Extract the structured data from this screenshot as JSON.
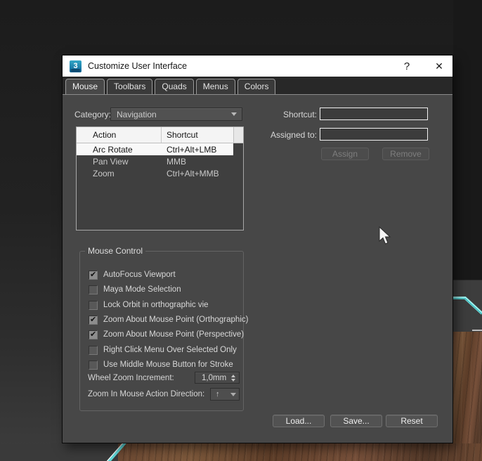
{
  "window": {
    "title": "Customize User Interface",
    "app_icon_text": "3",
    "help": "?",
    "close": "✕"
  },
  "tabs": {
    "items": [
      {
        "label": "Mouse"
      },
      {
        "label": "Toolbars"
      },
      {
        "label": "Quads"
      },
      {
        "label": "Menus"
      },
      {
        "label": "Colors"
      }
    ],
    "active": "Mouse"
  },
  "category": {
    "label": "Category:",
    "value": "Navigation"
  },
  "action_table": {
    "columns": [
      "Action",
      "Shortcut"
    ],
    "rows": [
      {
        "action": "Arc Rotate",
        "shortcut": "Ctrl+Alt+LMB",
        "selected": "true"
      },
      {
        "action": "Pan View",
        "shortcut": "MMB",
        "selected": "false"
      },
      {
        "action": "Zoom",
        "shortcut": "Ctrl+Alt+MMB",
        "selected": "false"
      }
    ]
  },
  "shortcut_panel": {
    "shortcut_label": "Shortcut:",
    "shortcut_value": "",
    "assigned_label": "Assigned to:",
    "assigned_value": "",
    "assign_button": "Assign",
    "remove_button": "Remove"
  },
  "mouse_control": {
    "title": "Mouse Control",
    "checkboxes": [
      {
        "label": "AutoFocus Viewport",
        "checked": "true"
      },
      {
        "label": "Maya Mode Selection",
        "checked": "false"
      },
      {
        "label": "Lock Orbit in orthographic vie",
        "checked": "false"
      },
      {
        "label": "Zoom About Mouse Point (Orthographic)",
        "checked": "true"
      },
      {
        "label": "Zoom About Mouse Point (Perspective)",
        "checked": "true"
      },
      {
        "label": "Right Click Menu Over Selected Only",
        "checked": "false"
      },
      {
        "label": "Use Middle Mouse Button for Stroke",
        "checked": "false"
      }
    ],
    "wheel_zoom": {
      "label": "Wheel Zoom Increment:",
      "value": "1,0mm"
    },
    "zoom_direction": {
      "label": "Zoom In Mouse Action Direction:",
      "value": "↑"
    }
  },
  "footer": {
    "load_button": "Load...",
    "save_button": "Save...",
    "reset_button": "Reset"
  },
  "colors": {
    "accent_cyan": "#63dede",
    "wood_brown": "#6b4832",
    "dialog_bg": "#474747",
    "titlebar_bg": "#ffffff"
  }
}
